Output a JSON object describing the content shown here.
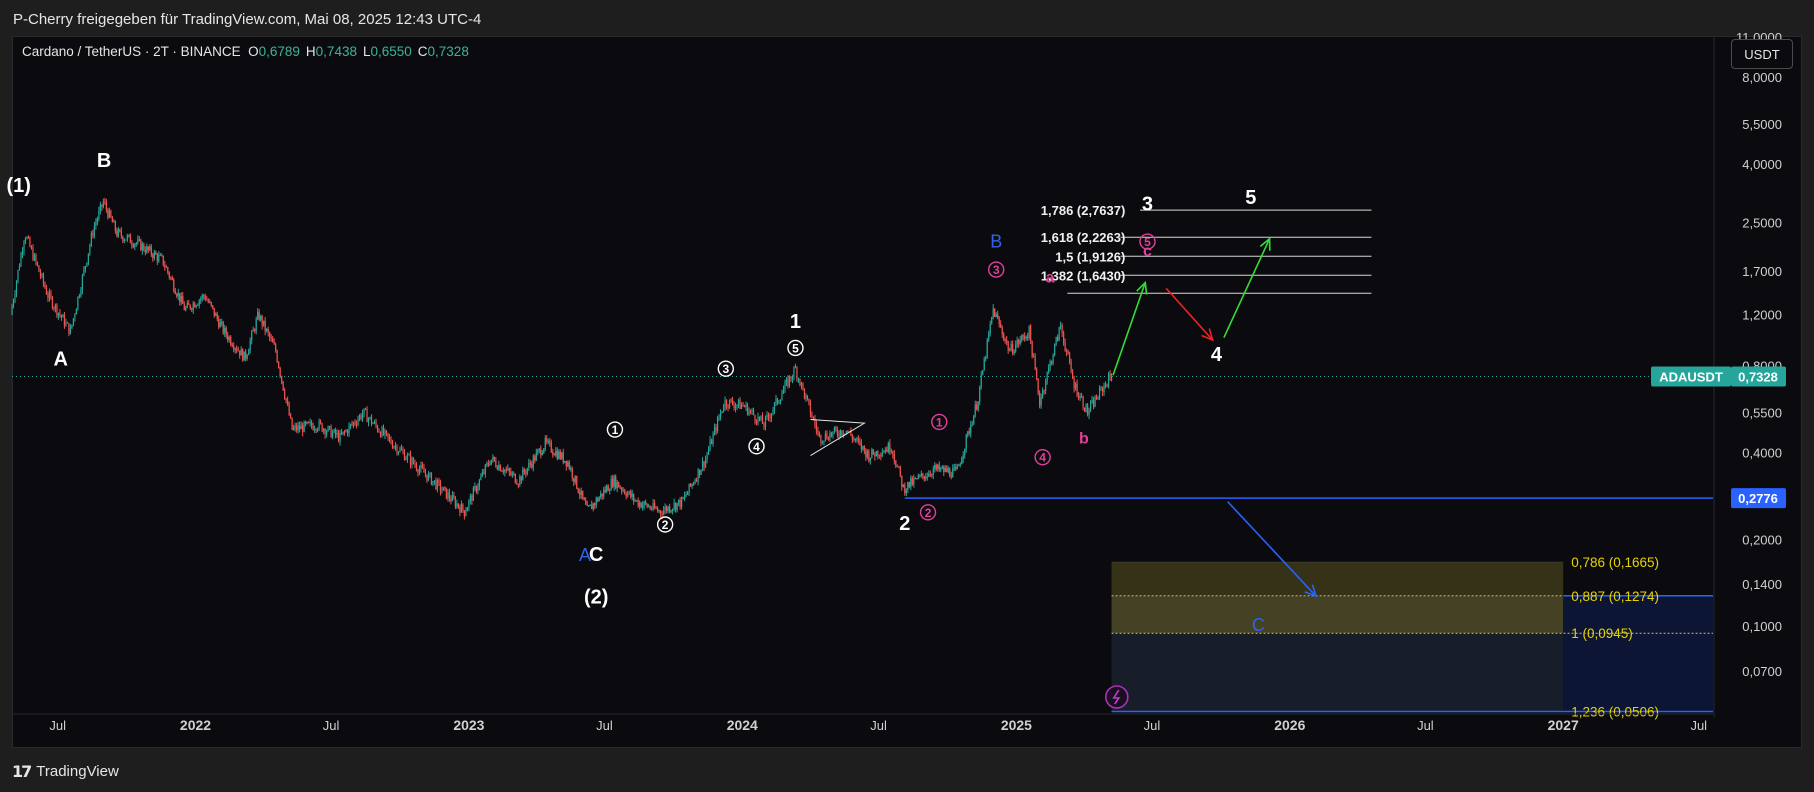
{
  "header": {
    "attribution": "P-Cherry freigegeben für TradingView.com, Mai 08, 2025 12:43 UTC-4"
  },
  "footer": {
    "logo_mark": "17",
    "logo_text": "TradingView"
  },
  "symbol_legend": {
    "symbol": "Cardano / TetherUS · 2T · BINANCE",
    "open_label": "O",
    "open": "0,6789",
    "high_label": "H",
    "high": "0,7438",
    "low_label": "L",
    "low": "0,6550",
    "close_label": "C",
    "close": "0,7328"
  },
  "currency_button": "USDT",
  "colors": {
    "background": "#0b0b0f",
    "up_candle": "#26a69a",
    "down_candle": "#ef5350",
    "white_wave": "#ffffff",
    "pink_wave": "#e0409a",
    "blue_wave": "#2e64e6",
    "green_arrow": "#33dd33",
    "red_arrow": "#ee2222",
    "price_tag": "#26a69a",
    "support_tag": "#2962ff",
    "fib_yellow": "#e6d400"
  },
  "chart_data": {
    "type": "candlestick",
    "symbol": "ADAUSDT",
    "y_scale": "log",
    "ylim": [
      0.05,
      11.0
    ],
    "y_ticks": [
      {
        "value": 11.0,
        "label": "11,0000"
      },
      {
        "value": 8.0,
        "label": "8,0000"
      },
      {
        "value": 5.5,
        "label": "5,5000"
      },
      {
        "value": 4.0,
        "label": "4,0000"
      },
      {
        "value": 2.5,
        "label": "2,5000"
      },
      {
        "value": 1.7,
        "label": "1,7000"
      },
      {
        "value": 1.2,
        "label": "1,2000"
      },
      {
        "value": 0.8,
        "label": "0,8000"
      },
      {
        "value": 0.55,
        "label": "0,5500"
      },
      {
        "value": 0.4,
        "label": "0,4000"
      },
      {
        "value": 0.2776,
        "label": "0,2776"
      },
      {
        "value": 0.2,
        "label": "0,2000"
      },
      {
        "value": 0.14,
        "label": "0,1400"
      },
      {
        "value": 0.1,
        "label": "0,1000"
      },
      {
        "value": 0.07,
        "label": "0,0700"
      }
    ],
    "x_range": [
      "2021-05-01",
      "2027-07-20"
    ],
    "x_ticks": [
      {
        "date": "2021-07-01",
        "label": "Jul",
        "bold": false
      },
      {
        "date": "2022-01-01",
        "label": "2022",
        "bold": true
      },
      {
        "date": "2022-07-01",
        "label": "Jul",
        "bold": false
      },
      {
        "date": "2023-01-01",
        "label": "2023",
        "bold": true
      },
      {
        "date": "2023-07-01",
        "label": "Jul",
        "bold": false
      },
      {
        "date": "2024-01-01",
        "label": "2024",
        "bold": true
      },
      {
        "date": "2024-07-01",
        "label": "Jul",
        "bold": false
      },
      {
        "date": "2025-01-01",
        "label": "2025",
        "bold": true
      },
      {
        "date": "2025-07-01",
        "label": "Jul",
        "bold": false
      },
      {
        "date": "2026-01-01",
        "label": "2026",
        "bold": true
      },
      {
        "date": "2026-07-01",
        "label": "Jul",
        "bold": false
      },
      {
        "date": "2027-01-01",
        "label": "2027",
        "bold": true
      },
      {
        "date": "2027-07-01",
        "label": "Jul",
        "bold": false
      }
    ],
    "price_path": [
      [
        "2021-05-01",
        1.2
      ],
      [
        "2021-05-20",
        2.3
      ],
      [
        "2021-06-20",
        1.4
      ],
      [
        "2021-07-20",
        1.05
      ],
      [
        "2021-08-20",
        2.4
      ],
      [
        "2021-09-02",
        2.95
      ],
      [
        "2021-09-20",
        2.3
      ],
      [
        "2021-10-20",
        2.1
      ],
      [
        "2021-11-20",
        1.85
      ],
      [
        "2021-12-20",
        1.25
      ],
      [
        "2022-01-15",
        1.4
      ],
      [
        "2022-02-10",
        1.05
      ],
      [
        "2022-03-10",
        0.85
      ],
      [
        "2022-03-28",
        1.2
      ],
      [
        "2022-04-20",
        0.9
      ],
      [
        "2022-05-12",
        0.48
      ],
      [
        "2022-06-15",
        0.5
      ],
      [
        "2022-07-15",
        0.45
      ],
      [
        "2022-08-15",
        0.55
      ],
      [
        "2022-09-15",
        0.45
      ],
      [
        "2022-10-15",
        0.38
      ],
      [
        "2022-11-15",
        0.32
      ],
      [
        "2022-12-28",
        0.25
      ],
      [
        "2023-02-01",
        0.38
      ],
      [
        "2023-03-10",
        0.32
      ],
      [
        "2023-04-15",
        0.43
      ],
      [
        "2023-05-15",
        0.37
      ],
      [
        "2023-06-10",
        0.25
      ],
      [
        "2023-07-15",
        0.32
      ],
      [
        "2023-08-15",
        0.27
      ],
      [
        "2023-09-15",
        0.25
      ],
      [
        "2023-10-15",
        0.27
      ],
      [
        "2023-11-15",
        0.38
      ],
      [
        "2023-12-10",
        0.6
      ],
      [
        "2024-01-05",
        0.58
      ],
      [
        "2024-02-01",
        0.5
      ],
      [
        "2024-03-14",
        0.78
      ],
      [
        "2024-04-15",
        0.45
      ],
      [
        "2024-05-20",
        0.48
      ],
      [
        "2024-06-20",
        0.39
      ],
      [
        "2024-07-20",
        0.42
      ],
      [
        "2024-08-05",
        0.3
      ],
      [
        "2024-09-15",
        0.35
      ],
      [
        "2024-10-15",
        0.34
      ],
      [
        "2024-11-12",
        0.6
      ],
      [
        "2024-12-03",
        1.25
      ],
      [
        "2024-12-25",
        0.9
      ],
      [
        "2025-01-20",
        1.05
      ],
      [
        "2025-02-03",
        0.6
      ],
      [
        "2025-03-03",
        1.1
      ],
      [
        "2025-03-20",
        0.7
      ],
      [
        "2025-04-08",
        0.55
      ],
      [
        "2025-05-08",
        0.7328
      ]
    ],
    "last_price": {
      "value": 0.7328,
      "label": "0,7328",
      "ticker_label": "ADAUSDT"
    },
    "support_line": {
      "value": 0.2776,
      "label": "0,2776",
      "from": "2024-08-05"
    },
    "fib_extension_labels": [
      {
        "value": 2.7637,
        "label": "1,786 (2,7637)"
      },
      {
        "value": 2.2263,
        "label": "1,618 (2,2263)"
      },
      {
        "value": 1.9126,
        "label": "1,5 (1,9126)"
      },
      {
        "value": 1.643,
        "label": "1,382 (1,6430)"
      }
    ],
    "fib_retracement_labels": [
      {
        "value": 0.1665,
        "label": "0,786 (0,1665)"
      },
      {
        "value": 0.1274,
        "label": "0,887 (0,1274)"
      },
      {
        "value": 0.0945,
        "label": "1 (0,0945)"
      },
      {
        "value": 0.0506,
        "label": "1,236 (0,0506)"
      }
    ],
    "wave_labels": [
      {
        "text": "(1)",
        "date": "2021-05-10",
        "price": 3.2,
        "style": "white"
      },
      {
        "text": "B",
        "date": "2021-09-01",
        "price": 3.9,
        "style": "white"
      },
      {
        "text": "A",
        "date": "2021-07-05",
        "price": 0.8,
        "style": "white"
      },
      {
        "text": "1",
        "date": "2024-03-12",
        "price": 1.08,
        "style": "white"
      },
      {
        "text": "2",
        "date": "2024-08-05",
        "price": 0.215,
        "style": "white"
      },
      {
        "text": "3",
        "date": "2025-06-25",
        "price": 2.75,
        "style": "white"
      },
      {
        "text": "4",
        "date": "2025-09-25",
        "price": 0.83,
        "style": "white"
      },
      {
        "text": "5",
        "date": "2025-11-10",
        "price": 2.9,
        "style": "white"
      },
      {
        "text": "C",
        "date": "2023-06-20",
        "price": 0.168,
        "style": "white"
      },
      {
        "text": "(2)",
        "date": "2023-06-20",
        "price": 0.12,
        "style": "white"
      },
      {
        "text": "A",
        "date": "2023-06-05",
        "price": 0.168,
        "style": "blue"
      },
      {
        "text": "B",
        "date": "2024-12-05",
        "price": 2.05,
        "style": "blue"
      },
      {
        "text": "C",
        "date": "2025-11-20",
        "price": 0.096,
        "style": "blue"
      },
      {
        "text": "a",
        "date": "2025-02-15",
        "price": 1.55,
        "style": "pink_letter"
      },
      {
        "text": "b",
        "date": "2025-04-01",
        "price": 0.43,
        "style": "pink_letter"
      },
      {
        "text": "c",
        "date": "2025-06-25",
        "price": 1.92,
        "style": "pink_letter"
      }
    ],
    "circled_labels": [
      {
        "text": "1",
        "date": "2023-07-15",
        "price": 0.48,
        "style": "white"
      },
      {
        "text": "2",
        "date": "2023-09-20",
        "price": 0.225,
        "style": "white"
      },
      {
        "text": "3",
        "date": "2023-12-10",
        "price": 0.78,
        "style": "white"
      },
      {
        "text": "4",
        "date": "2024-01-20",
        "price": 0.42,
        "style": "white"
      },
      {
        "text": "5",
        "date": "2024-03-12",
        "price": 0.92,
        "style": "white"
      },
      {
        "text": "1",
        "date": "2024-09-20",
        "price": 0.51,
        "style": "pink"
      },
      {
        "text": "2",
        "date": "2024-09-05",
        "price": 0.248,
        "style": "pink"
      },
      {
        "text": "3",
        "date": "2024-12-05",
        "price": 1.72,
        "style": "pink"
      },
      {
        "text": "4",
        "date": "2025-02-05",
        "price": 0.385,
        "style": "pink"
      },
      {
        "text": "5",
        "date": "2025-06-25",
        "price": 2.15,
        "style": "pink"
      }
    ]
  }
}
